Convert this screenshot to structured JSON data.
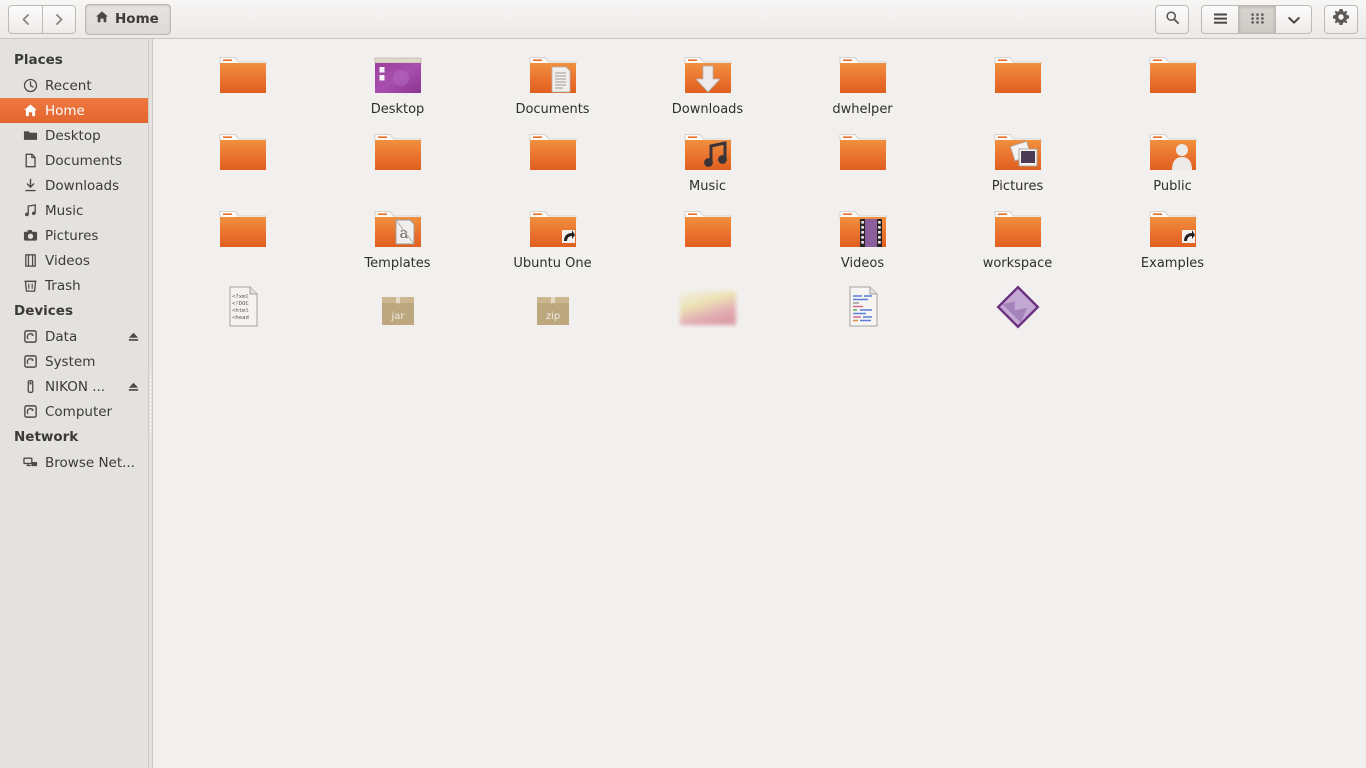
{
  "window": {
    "title": "Home"
  },
  "toolbar": {
    "back_label": "Back",
    "forward_label": "Forward",
    "breadcrumb_label": "Home",
    "search_label": "Search",
    "list_view_label": "List view",
    "grid_view_label": "Icon view",
    "view_options_label": "View options",
    "settings_label": "Settings"
  },
  "sidebar": {
    "sections": [
      {
        "heading": "Places",
        "items": [
          {
            "label": "Recent",
            "icon": "clock-icon",
            "selected": false,
            "eject": false
          },
          {
            "label": "Home",
            "icon": "home-icon",
            "selected": true,
            "eject": false
          },
          {
            "label": "Desktop",
            "icon": "folder-icon",
            "selected": false,
            "eject": false
          },
          {
            "label": "Documents",
            "icon": "document-icon",
            "selected": false,
            "eject": false
          },
          {
            "label": "Downloads",
            "icon": "download-icon",
            "selected": false,
            "eject": false
          },
          {
            "label": "Music",
            "icon": "music-icon",
            "selected": false,
            "eject": false
          },
          {
            "label": "Pictures",
            "icon": "camera-icon",
            "selected": false,
            "eject": false
          },
          {
            "label": "Videos",
            "icon": "film-icon",
            "selected": false,
            "eject": false
          },
          {
            "label": "Trash",
            "icon": "trash-icon",
            "selected": false,
            "eject": false
          }
        ]
      },
      {
        "heading": "Devices",
        "items": [
          {
            "label": "Data",
            "icon": "disk-icon",
            "selected": false,
            "eject": true
          },
          {
            "label": "System",
            "icon": "disk-icon",
            "selected": false,
            "eject": false
          },
          {
            "label": "NIKON ...",
            "icon": "drive-icon",
            "selected": false,
            "eject": true
          },
          {
            "label": "Computer",
            "icon": "disk-icon",
            "selected": false,
            "eject": false
          }
        ]
      },
      {
        "heading": "Network",
        "items": [
          {
            "label": "Browse Net...",
            "icon": "network-icon",
            "selected": false,
            "eject": false
          }
        ]
      }
    ]
  },
  "files": {
    "items": [
      {
        "name": "",
        "redacted": true,
        "icon": "folder-plain-icon"
      },
      {
        "name": "Desktop",
        "redacted": false,
        "icon": "folder-desktop-icon"
      },
      {
        "name": "Documents",
        "redacted": false,
        "icon": "folder-documents-icon"
      },
      {
        "name": "Downloads",
        "redacted": false,
        "icon": "folder-downloads-icon"
      },
      {
        "name": "dwhelper",
        "redacted": false,
        "icon": "folder-plain-icon"
      },
      {
        "name": "",
        "redacted": true,
        "icon": "folder-plain-icon"
      },
      {
        "name": "",
        "redacted": true,
        "icon": "folder-plain-icon"
      },
      {
        "name": "",
        "redacted": true,
        "icon": "folder-plain-icon"
      },
      {
        "name": "",
        "redacted": true,
        "icon": "folder-plain-icon"
      },
      {
        "name": "",
        "redacted": true,
        "icon": "folder-plain-icon"
      },
      {
        "name": "Music",
        "redacted": false,
        "icon": "folder-music-icon"
      },
      {
        "name": "",
        "redacted": true,
        "icon": "folder-plain-icon"
      },
      {
        "name": "Pictures",
        "redacted": false,
        "icon": "folder-pictures-icon"
      },
      {
        "name": "Public",
        "redacted": false,
        "icon": "folder-public-icon"
      },
      {
        "name": "",
        "redacted": true,
        "icon": "folder-plain-icon"
      },
      {
        "name": "Templates",
        "redacted": false,
        "icon": "folder-templates-icon"
      },
      {
        "name": "Ubuntu One",
        "redacted": false,
        "icon": "folder-link-icon"
      },
      {
        "name": "",
        "redacted": true,
        "icon": "folder-plain-icon"
      },
      {
        "name": "Videos",
        "redacted": false,
        "icon": "folder-videos-icon"
      },
      {
        "name": "workspace",
        "redacted": false,
        "icon": "folder-plain-icon"
      },
      {
        "name": "Examples",
        "redacted": false,
        "icon": "folder-link-icon"
      },
      {
        "name": "",
        "redacted": true,
        "icon": "xml-file-icon"
      },
      {
        "name": "",
        "redacted": true,
        "icon": "jar-archive-icon"
      },
      {
        "name": "",
        "redacted": true,
        "icon": "zip-archive-icon"
      },
      {
        "name": "",
        "redacted": true,
        "icon": "image-thumbnail-icon"
      },
      {
        "name": "",
        "redacted": true,
        "icon": "text-code-file-icon"
      },
      {
        "name": "",
        "redacted": true,
        "icon": "diamond-image-icon"
      }
    ],
    "archive_labels": {
      "jar": "jar",
      "zip": "zip"
    },
    "xml_preview_lines": [
      "<?xml",
      "<!DOC",
      "<html",
      "<head"
    ]
  },
  "colors": {
    "accent": "#e8703a",
    "sidebar_bg": "#e4e2df",
    "content_bg": "#f1f0ee",
    "toolbar_bg": "#f2f0ee",
    "folder_orange": "#e8702a",
    "text": "#3b3a38"
  }
}
